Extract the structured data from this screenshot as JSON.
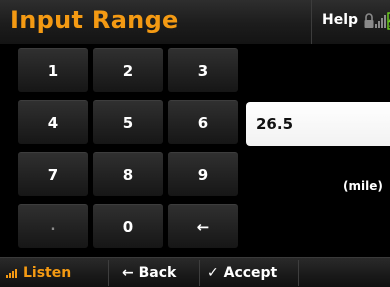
{
  "header": {
    "title": "Input Range",
    "help_label": "Help"
  },
  "keypad": {
    "keys": [
      {
        "label": "1"
      },
      {
        "label": "2"
      },
      {
        "label": "3"
      },
      {
        "label": "4"
      },
      {
        "label": "5"
      },
      {
        "label": "6"
      },
      {
        "label": "7"
      },
      {
        "label": "8"
      },
      {
        "label": "9"
      },
      {
        "label": "."
      },
      {
        "label": "0"
      },
      {
        "label": "←"
      }
    ]
  },
  "input": {
    "value": "26.5",
    "unit": "(mile)"
  },
  "bottom_bar": {
    "listen_label": "Listen",
    "back_label": "← Back",
    "accept_label": "✓ Accept"
  },
  "colors": {
    "accent": "#f49a13",
    "battery": "#6fd420",
    "background": "#000000"
  },
  "icons": [
    "lock-icon",
    "signal-icon",
    "battery-icon",
    "listen-signal-icon"
  ]
}
